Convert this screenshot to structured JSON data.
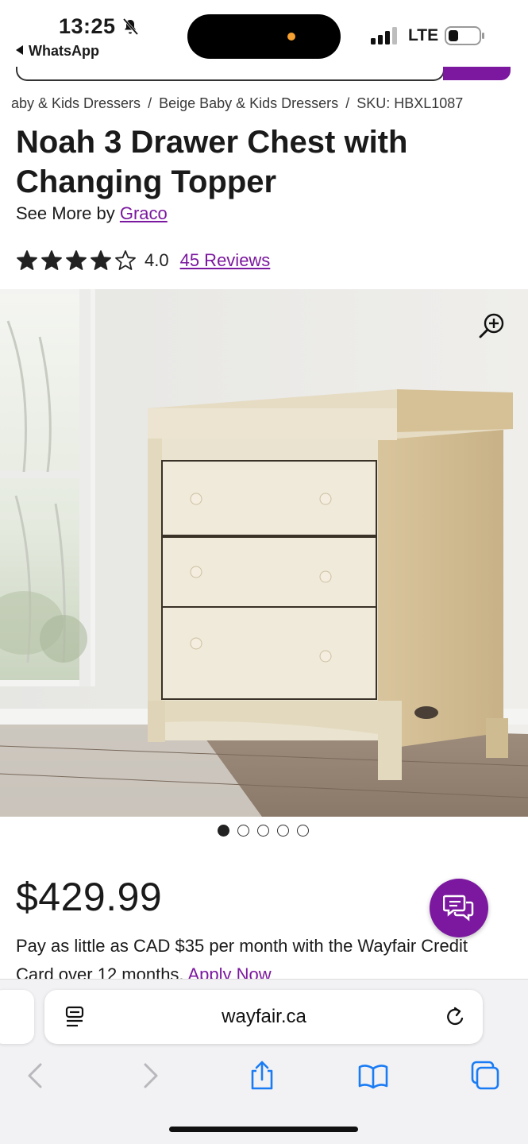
{
  "status_bar": {
    "time": "13:25",
    "back_app": "WhatsApp",
    "network": "LTE"
  },
  "breadcrumb": {
    "items": [
      "aby & Kids Dressers",
      "Beige Baby & Kids Dressers",
      "SKU: HBXL1087"
    ],
    "separator": "/"
  },
  "product": {
    "title": "Noah 3 Drawer Chest with Changing Topper",
    "see_more_prefix": "See More by",
    "brand": "Graco",
    "rating": {
      "stars_filled": 4,
      "stars_total": 5,
      "value_label": "4.0",
      "reviews_label": "45 Reviews"
    },
    "image": {
      "icon": "zoom-in-icon",
      "carousel_count": 5,
      "carousel_active": 1
    },
    "price": "$429.99",
    "financing_text": "Pay as little as CAD $35 per month with the Wayfair Credit Card over 12 months.",
    "financing_link": "Apply Now"
  },
  "chat": {
    "icon": "chat-icon"
  },
  "browser": {
    "url": "wayfair.ca",
    "icons": [
      "reader-icon",
      "reload-icon",
      "back-icon",
      "forward-icon",
      "share-icon",
      "bookmarks-icon",
      "tabs-icon"
    ]
  },
  "colors": {
    "brand_purple": "#7b189f",
    "text": "#1a1a1a",
    "safari_bar": "#f2f2f4"
  }
}
